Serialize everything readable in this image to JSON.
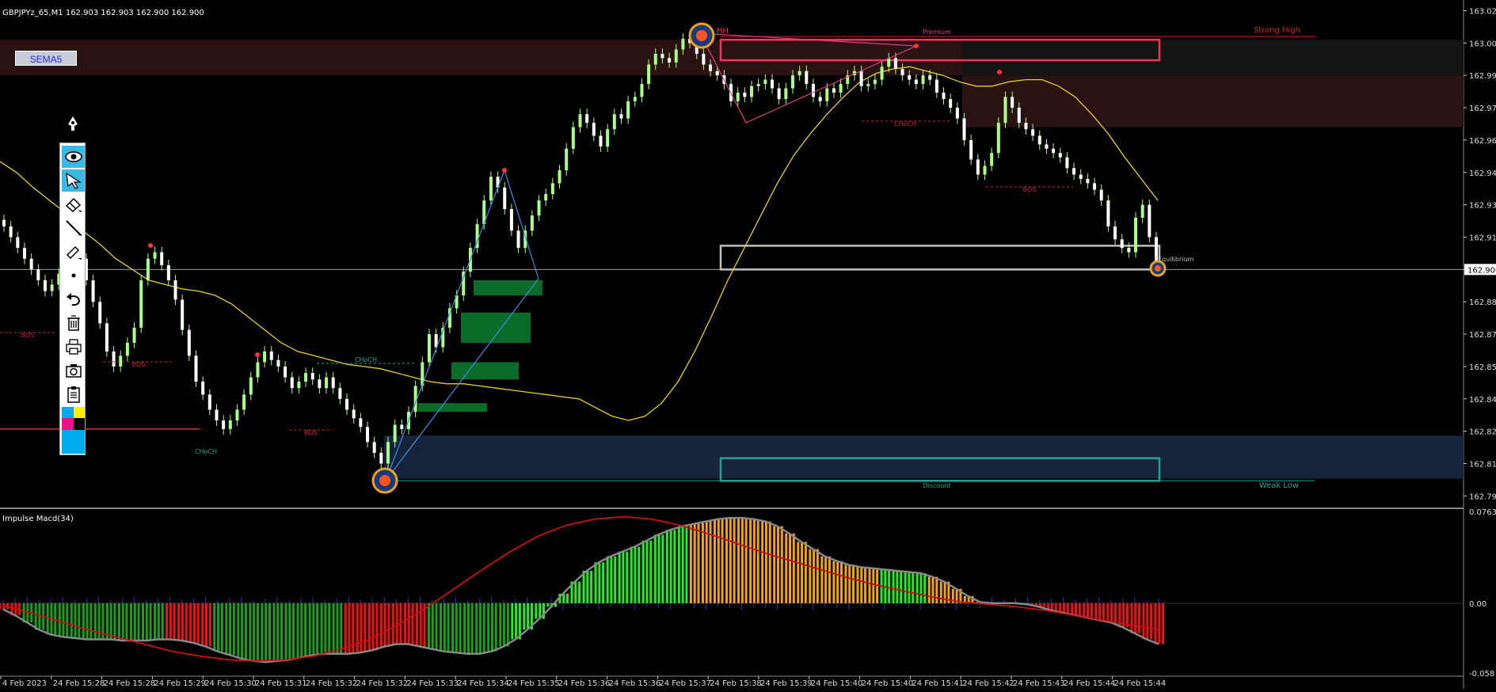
{
  "header": {
    "symbol_info": "GBPJPYz_65,M1  162.903 162.903 162.900 162.900"
  },
  "buttons": {
    "sema_label": "SEMA5"
  },
  "toolbar_icons": [
    "pen-icon",
    "eye-icon",
    "cursor-icon",
    "eraser-icon",
    "line-icon",
    "brush-icon",
    "dot-icon",
    "undo-icon",
    "trash-icon",
    "print-icon",
    "camera-icon",
    "clipboard-icon",
    "color-palette-icon"
  ],
  "colors": {
    "background": "#000000",
    "bull_candle": "#aaff88",
    "ma_line": "#e6d21e",
    "premium_zone": "#2a1212",
    "discount_zone": "#16233a",
    "order_block": "#0d6b2a",
    "premium_box": "#f0365a",
    "discount_box": "#1ea392",
    "equilibrium_box": "#bfbfbf",
    "macd_green": "#1aa01a",
    "macd_lime": "#22ee22",
    "macd_orange": "#f2a11b",
    "macd_red": "#ee1111",
    "macd_blue": "#2233cc",
    "signal_line": "#cc1111"
  },
  "chart_data": [
    {
      "type": "line",
      "title": "GBPJPYz_65,M1",
      "ylim": [
        162.79,
        163.022
      ],
      "y_ticks": [
        "163.020",
        "163.005",
        "162.990",
        "162.975",
        "162.960",
        "162.945",
        "162.930",
        "162.915",
        "162.900",
        "162.885",
        "162.870",
        "162.855",
        "162.840",
        "162.825",
        "162.810",
        "162.795"
      ],
      "x_ticks": [
        "4 Feb 2023",
        "24 Feb 15:28",
        "24 Feb 15:28",
        "24 Feb 15:29",
        "24 Feb 15:30",
        "24 Feb 15:31",
        "24 Feb 15:32",
        "24 Feb 15:32",
        "24 Feb 15:33",
        "24 Feb 15:34",
        "24 Feb 15:35",
        "24 Feb 15:36",
        "24 Feb 15:36",
        "24 Feb 15:37",
        "24 Feb 15:38",
        "24 Feb 15:39",
        "24 Feb 15:40",
        "24 Feb 15:40",
        "24 Feb 15:41",
        "24 Feb 15:42",
        "24 Feb 15:43",
        "24 Feb 15:44",
        "24 Feb 15:44"
      ],
      "current_price": "162.900",
      "close": [
        162.92,
        162.915,
        162.91,
        162.905,
        162.9,
        162.895,
        162.89,
        162.893,
        162.898,
        162.905,
        162.91,
        162.905,
        162.895,
        162.885,
        162.875,
        162.862,
        162.855,
        162.86,
        162.866,
        162.873,
        162.895,
        162.905,
        162.908,
        162.902,
        162.895,
        162.886,
        162.872,
        162.86,
        162.848,
        162.842,
        162.835,
        162.83,
        162.826,
        162.83,
        162.835,
        162.842,
        162.85,
        162.857,
        162.862,
        162.858,
        162.855,
        162.85,
        162.845,
        162.848,
        162.852,
        162.849,
        162.845,
        162.85,
        162.845,
        162.84,
        162.835,
        162.831,
        162.827,
        162.82,
        162.815,
        162.81,
        162.82,
        162.828,
        162.826,
        162.834,
        162.846,
        162.857,
        162.87,
        162.864,
        162.873,
        162.882,
        162.888,
        162.899,
        162.91,
        162.921,
        162.932,
        162.943,
        162.938,
        162.928,
        162.918,
        162.91,
        162.918,
        162.925,
        162.932,
        162.935,
        162.94,
        162.946,
        162.956,
        162.966,
        162.972,
        162.968,
        162.962,
        162.957,
        162.965,
        162.972,
        162.97,
        162.978,
        162.98,
        162.986,
        162.995,
        163.0,
        162.998,
        162.996,
        163.002,
        163.007,
        163.005,
        163.0,
        162.995,
        162.992,
        162.99,
        162.986,
        162.978,
        162.982,
        162.98,
        162.985,
        162.986,
        162.988,
        162.984,
        162.979,
        162.984,
        162.99,
        162.992,
        162.986,
        162.98,
        162.978,
        162.984,
        162.982,
        162.986,
        162.99,
        162.992,
        162.985,
        162.986,
        162.988,
        162.994,
        162.998,
        162.993,
        162.99,
        162.988,
        162.986,
        162.99,
        162.988,
        162.982,
        162.979,
        162.975,
        162.97,
        162.96,
        162.951,
        162.944,
        162.948,
        162.954,
        162.968,
        162.98,
        162.975,
        162.968,
        162.965,
        162.962,
        162.958,
        162.956,
        162.954,
        162.952,
        162.947,
        162.944,
        162.942,
        162.94,
        162.937,
        162.932,
        162.92,
        162.914,
        162.91,
        162.908,
        162.924,
        162.93,
        162.915,
        162.9
      ],
      "ma_line": [
        162.95,
        162.945,
        162.938,
        162.932,
        162.926,
        162.918,
        162.912,
        162.905,
        162.9,
        162.895,
        162.893,
        162.891,
        162.89,
        162.888,
        162.884,
        162.878,
        162.872,
        162.866,
        162.862,
        162.86,
        162.858,
        162.856,
        162.855,
        162.854,
        162.852,
        162.85,
        162.848,
        162.847,
        162.847,
        162.846,
        162.845,
        162.844,
        162.843,
        162.842,
        162.841,
        162.84,
        162.836,
        162.832,
        162.83,
        162.832,
        162.838,
        162.848,
        162.862,
        162.878,
        162.895,
        162.91,
        162.925,
        162.94,
        162.953,
        162.963,
        162.972,
        162.98,
        162.987,
        162.991,
        162.993,
        162.994,
        162.992,
        162.99,
        162.987,
        162.985,
        162.985,
        162.987,
        162.988,
        162.988,
        162.985,
        162.98,
        162.972,
        162.963,
        162.952,
        162.942,
        162.932
      ]
    },
    {
      "type": "bar",
      "title": "Impulse Macd(34)",
      "ylim": [
        -0.058,
        0.0763
      ],
      "y_ticks": [
        "0.0763",
        "0.00",
        "-0.058"
      ],
      "hist": [
        -0.005,
        -0.01,
        -0.016,
        -0.022,
        -0.026,
        -0.028,
        -0.029,
        -0.03,
        -0.03,
        -0.03,
        -0.031,
        -0.031,
        -0.031,
        -0.03,
        -0.03,
        -0.031,
        -0.033,
        -0.036,
        -0.04,
        -0.043,
        -0.046,
        -0.048,
        -0.049,
        -0.048,
        -0.047,
        -0.045,
        -0.043,
        -0.042,
        -0.042,
        -0.042,
        -0.041,
        -0.039,
        -0.036,
        -0.034,
        -0.034,
        -0.036,
        -0.038,
        -0.04,
        -0.041,
        -0.042,
        -0.042,
        -0.04,
        -0.036,
        -0.03,
        -0.022,
        -0.013,
        -0.003,
        0.008,
        0.018,
        0.027,
        0.034,
        0.039,
        0.043,
        0.047,
        0.052,
        0.057,
        0.061,
        0.064,
        0.066,
        0.068,
        0.07,
        0.071,
        0.071,
        0.07,
        0.068,
        0.064,
        0.058,
        0.051,
        0.045,
        0.039,
        0.035,
        0.032,
        0.03,
        0.029,
        0.028,
        0.027,
        0.026,
        0.025,
        0.022,
        0.018,
        0.012,
        0.006,
        0.001,
        0.0,
        0.0,
        0.0,
        -0.001,
        -0.003,
        -0.006,
        -0.008,
        -0.01,
        -0.012,
        -0.014,
        -0.016,
        -0.02,
        -0.025,
        -0.03,
        -0.034
      ],
      "hist_colors": [
        "r",
        "r",
        "g",
        "g",
        "g",
        "g",
        "g",
        "g",
        "g",
        "g",
        "g",
        "g",
        "g",
        "g",
        "r",
        "r",
        "r",
        "r",
        "g",
        "g",
        "g",
        "g",
        "g",
        "g",
        "g",
        "g",
        "g",
        "g",
        "g",
        "r",
        "r",
        "r",
        "r",
        "r",
        "r",
        "r",
        "g",
        "g",
        "g",
        "g",
        "g",
        "g",
        "g",
        "l",
        "l",
        "l",
        "l",
        "l",
        "l",
        "l",
        "l",
        "l",
        "l",
        "l",
        "l",
        "l",
        "l",
        "l",
        "o",
        "o",
        "o",
        "o",
        "o",
        "o",
        "o",
        "o",
        "o",
        "o",
        "o",
        "o",
        "o",
        "o",
        "o",
        "o",
        "l",
        "l",
        "l",
        "l",
        "o",
        "o",
        "o",
        "o",
        "o",
        "o",
        "o",
        "o",
        "r",
        "r",
        "r",
        "r",
        "r",
        "r",
        "r",
        "r",
        "r",
        "r",
        "r",
        "r"
      ],
      "signal_line": [
        -0.002,
        -0.008,
        -0.015,
        -0.022,
        -0.028,
        -0.034,
        -0.04,
        -0.044,
        -0.047,
        -0.048,
        -0.047,
        -0.044,
        -0.038,
        -0.03,
        -0.018,
        -0.004,
        0.012,
        0.028,
        0.043,
        0.056,
        0.065,
        0.07,
        0.072,
        0.07,
        0.065,
        0.058,
        0.05,
        0.042,
        0.035,
        0.028,
        0.021,
        0.015,
        0.01,
        0.005,
        0.001,
        -0.001,
        -0.003,
        -0.006,
        -0.01,
        -0.014,
        -0.018,
        -0.022
      ]
    }
  ],
  "annotations": {
    "hh": "HH",
    "premium": "Premium",
    "strong_high": "Strong High",
    "equilibrium": "Equilibrium",
    "discount": "Discount",
    "weak_low": "Weak Low",
    "bos": "BOS",
    "choch": "CHoCH"
  }
}
